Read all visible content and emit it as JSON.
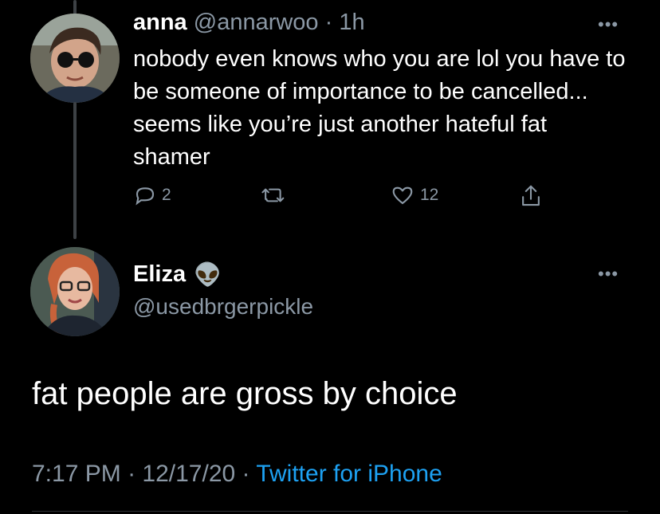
{
  "reply": {
    "display_name": "anna",
    "handle": "@annarwoo",
    "separator": "·",
    "time": "1h",
    "more_label": "•••",
    "text": "nobody even knows who you are lol you have to be someone of importance to be cancelled... seems like you’re just another hateful fat shamer",
    "actions": {
      "reply_count": "2",
      "retweet_count": "",
      "like_count": "12"
    },
    "icons": [
      "reply-icon",
      "retweet-icon",
      "like-icon",
      "share-icon"
    ]
  },
  "main_tweet": {
    "display_name": "Eliza",
    "emoji": "👽",
    "handle": "@usedbrgerpickle",
    "more_label": "•••",
    "text": "fat people are gross by choice",
    "time": "7:17 PM",
    "date": "12/17/20",
    "source": "Twitter for iPhone",
    "separator": "·"
  },
  "colors": {
    "background": "#000000",
    "text": "#ffffff",
    "muted": "#8b98a5",
    "link": "#1da1f2"
  }
}
